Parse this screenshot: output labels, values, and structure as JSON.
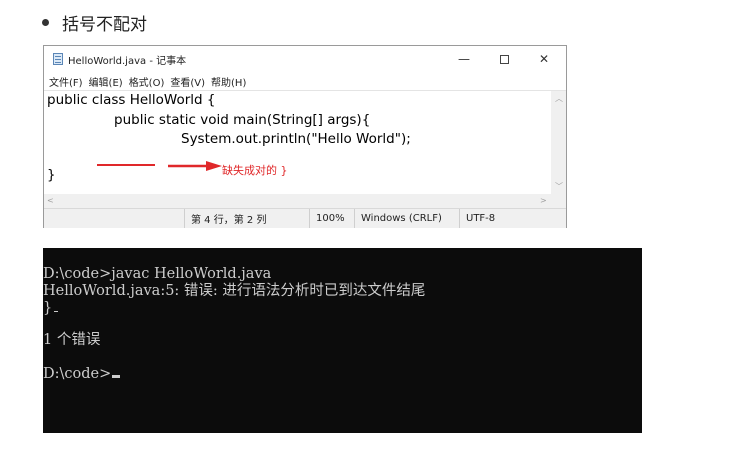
{
  "heading": {
    "text": "括号不配对"
  },
  "notepad": {
    "title": "HelloWorld.java - 记事本",
    "controls": {
      "minimize": "—",
      "close": "✕"
    },
    "menu": [
      "文件(F)",
      "编辑(E)",
      "格式(O)",
      "查看(V)",
      "帮助(H)"
    ],
    "code_lines": [
      "public class HelloWorld {",
      "public static void main(String[] args){",
      "System.out.println(\"Hello World\");",
      "}"
    ],
    "status": {
      "position": "第 4 行，第 2 列",
      "zoom": "100%",
      "line_ending": "Windows (CRLF)",
      "encoding": "UTF-8"
    }
  },
  "annotation": {
    "text": "缺失成对的 }",
    "color": "#e0282a"
  },
  "console": {
    "lines": [
      "D:\\code>javac HelloWorld.java",
      "HelloWorld.java:5: 错误: 进行语法分析时已到达文件结尾",
      "}",
      "1 个错误",
      "D:\\code>"
    ],
    "background": "#0c0c0c",
    "foreground": "#cccccc"
  }
}
